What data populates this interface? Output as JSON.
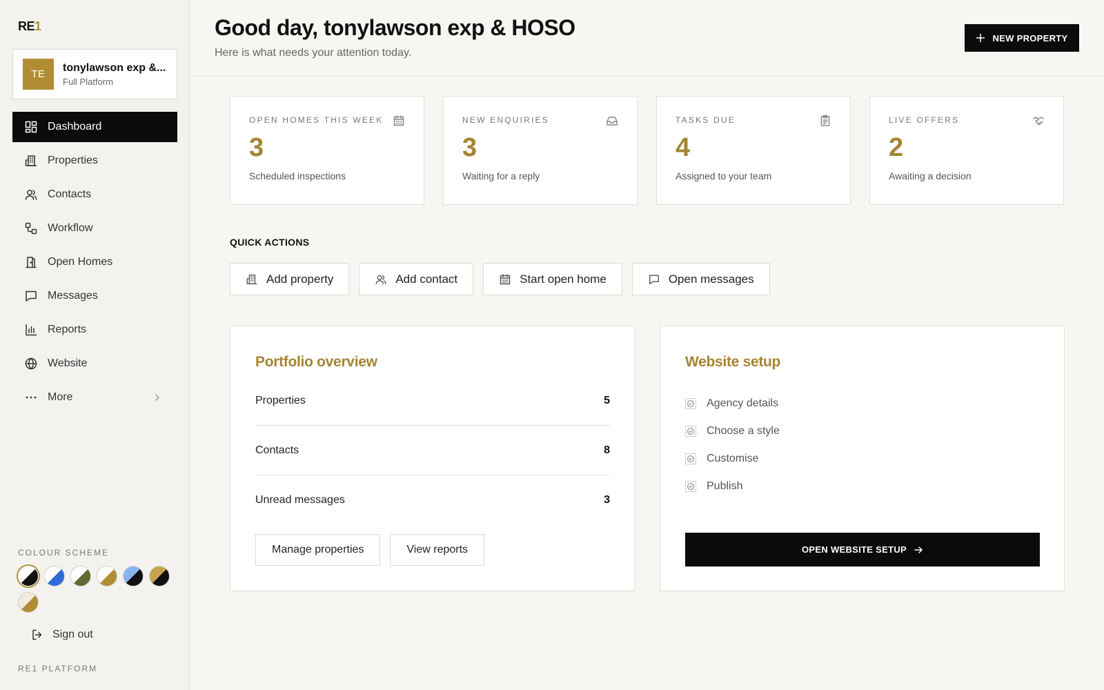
{
  "brand": {
    "logo_text": "RE",
    "logo_accent": "1",
    "accent_color": "#b08d35"
  },
  "account": {
    "initials": "TE",
    "name": "tonylawson exp &...",
    "plan": "Full Platform"
  },
  "nav": {
    "items": [
      {
        "label": "Dashboard",
        "icon": "dashboard-icon",
        "active": true
      },
      {
        "label": "Properties",
        "icon": "building-icon"
      },
      {
        "label": "Contacts",
        "icon": "users-icon"
      },
      {
        "label": "Workflow",
        "icon": "workflow-icon"
      },
      {
        "label": "Open Homes",
        "icon": "door-icon"
      },
      {
        "label": "Messages",
        "icon": "message-icon"
      },
      {
        "label": "Reports",
        "icon": "bar-chart-icon"
      },
      {
        "label": "Website",
        "icon": "globe-icon"
      },
      {
        "label": "More",
        "icon": "more-icon"
      }
    ]
  },
  "colour_scheme": {
    "label": "COLOUR SCHEME",
    "swatches": [
      {
        "a": "#111111",
        "b": "#ffffff",
        "selected": true
      },
      {
        "a": "#2f6ad9",
        "b": "#ffffff"
      },
      {
        "a": "#5e6b35",
        "b": "#ffffff"
      },
      {
        "a": "#b08d35",
        "b": "#ffffff"
      },
      {
        "a": "#111111",
        "b": "#8ab4f0"
      },
      {
        "a": "#111111",
        "b": "#c9a24f"
      },
      {
        "a": "#b08d35",
        "b": "#f1ebdd"
      }
    ]
  },
  "signout_label": "Sign out",
  "platform_label": "RE1 PLATFORM",
  "header": {
    "greeting": "Good day, tonylawson exp & HOSO",
    "subgreeting": "Here is what needs your attention today.",
    "new_property_label": "NEW PROPERTY"
  },
  "stats": [
    {
      "label": "OPEN HOMES THIS WEEK",
      "value": "3",
      "desc": "Scheduled inspections",
      "icon": "calendar-icon"
    },
    {
      "label": "NEW ENQUIRIES",
      "value": "3",
      "desc": "Waiting for a reply",
      "icon": "inbox-icon"
    },
    {
      "label": "TASKS DUE",
      "value": "4",
      "desc": "Assigned to your team",
      "icon": "clipboard-icon"
    },
    {
      "label": "LIVE OFFERS",
      "value": "2",
      "desc": "Awaiting a decision",
      "icon": "handshake-icon"
    }
  ],
  "quick_actions": {
    "title": "QUICK ACTIONS",
    "items": [
      {
        "label": "Add property",
        "icon": "building-icon"
      },
      {
        "label": "Add contact",
        "icon": "users-icon"
      },
      {
        "label": "Start open home",
        "icon": "calendar-icon"
      },
      {
        "label": "Open messages",
        "icon": "message-icon"
      }
    ]
  },
  "portfolio": {
    "title": "Portfolio overview",
    "rows": [
      {
        "label": "Properties",
        "value": "5"
      },
      {
        "label": "Contacts",
        "value": "8"
      },
      {
        "label": "Unread messages",
        "value": "3"
      }
    ],
    "manage_label": "Manage properties",
    "reports_label": "View reports"
  },
  "website_setup": {
    "title": "Website setup",
    "steps": [
      "Agency details",
      "Choose a style",
      "Customise",
      "Publish"
    ],
    "button_label": "OPEN WEBSITE SETUP"
  }
}
